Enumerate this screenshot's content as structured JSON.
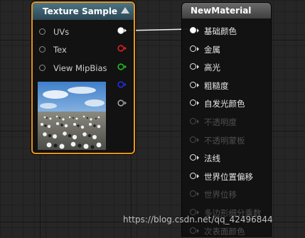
{
  "texture_node": {
    "title": "Texture Sample",
    "inputs": [
      {
        "label": "UVs"
      },
      {
        "label": "Tex"
      },
      {
        "label": "View MipBias"
      }
    ],
    "outputs": [
      {
        "color": "#ffffff",
        "connected": true
      },
      {
        "color": "#e02020",
        "connected": false
      },
      {
        "color": "#20c020",
        "connected": false
      },
      {
        "color": "#2030e0",
        "connected": false
      },
      {
        "color": "#a0a0a0",
        "connected": false
      }
    ],
    "selection_color": "#e8941a"
  },
  "material_node": {
    "title": "NewMaterial",
    "pins": [
      {
        "label": "基础颜色",
        "enabled": true,
        "connected": true
      },
      {
        "label": "金属",
        "enabled": true,
        "connected": false
      },
      {
        "label": "高光",
        "enabled": true,
        "connected": false
      },
      {
        "label": "粗糙度",
        "enabled": true,
        "connected": false
      },
      {
        "label": "自发光颜色",
        "enabled": true,
        "connected": false
      },
      {
        "label": "不透明度",
        "enabled": false,
        "connected": false
      },
      {
        "label": "不透明蒙板",
        "enabled": false,
        "connected": false
      },
      {
        "label": "法线",
        "enabled": true,
        "connected": false
      },
      {
        "label": "世界位置偏移",
        "enabled": true,
        "connected": false
      },
      {
        "label": "世界位移",
        "enabled": false,
        "connected": false
      },
      {
        "label": "多边形细分乘数",
        "enabled": false,
        "connected": false
      },
      {
        "label": "次表面颜色",
        "enabled": false,
        "connected": false
      }
    ]
  },
  "watermark": "https://blog.csdn.net/qq_42496844"
}
